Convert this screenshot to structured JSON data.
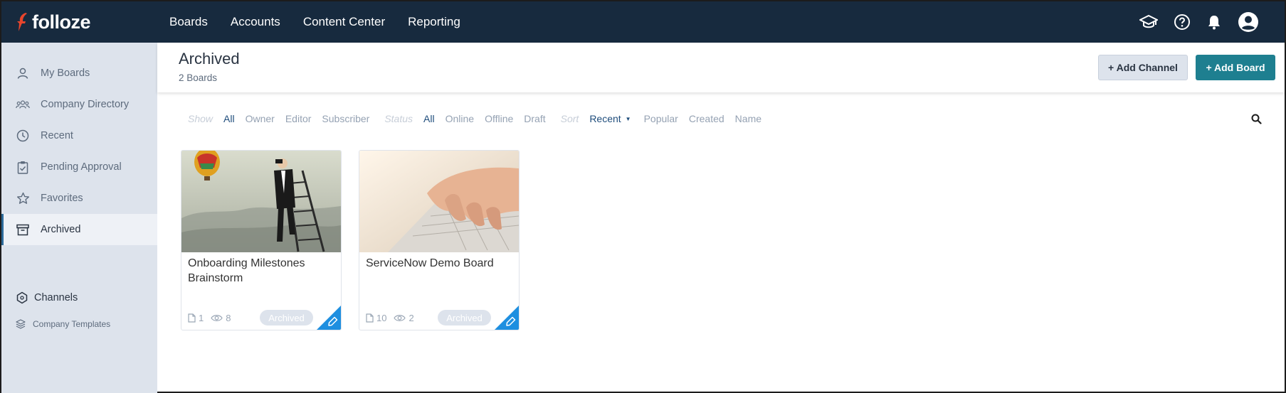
{
  "app": {
    "logo_text": "folloze"
  },
  "topnav": {
    "items": [
      "Boards",
      "Accounts",
      "Content Center",
      "Reporting"
    ]
  },
  "top_icons": [
    "graduation-cap-icon",
    "help-icon",
    "bell-icon",
    "user-account-icon"
  ],
  "sidebar": {
    "items": [
      {
        "label": "My Boards",
        "icon": "user-icon"
      },
      {
        "label": "Company Directory",
        "icon": "group-icon"
      },
      {
        "label": "Recent",
        "icon": "clock-icon"
      },
      {
        "label": "Pending Approval",
        "icon": "clipboard-check-icon"
      },
      {
        "label": "Favorites",
        "icon": "star-icon"
      },
      {
        "label": "Archived",
        "icon": "archive-icon",
        "active": true
      }
    ],
    "channels_label": "Channels",
    "templates_label": "Company Templates"
  },
  "header": {
    "title": "Archived",
    "subtitle": "2 Boards",
    "add_channel": "+ Add Channel",
    "add_board": "+ Add Board"
  },
  "filters": {
    "show_label": "Show",
    "show_options": [
      "All",
      "Owner",
      "Editor",
      "Subscriber"
    ],
    "status_label": "Status",
    "status_options": [
      "All",
      "Online",
      "Offline",
      "Draft"
    ],
    "sort_label": "Sort",
    "sort_options": [
      "Recent",
      "Popular",
      "Created",
      "Name"
    ],
    "show_selected": "All",
    "status_selected": "All",
    "sort_selected": "Recent"
  },
  "boards": [
    {
      "title": "Onboarding Milestones Brainstorm",
      "items": "1",
      "views": "8",
      "status": "Archived"
    },
    {
      "title": "ServiceNow Demo Board",
      "items": "10",
      "views": "2",
      "status": "Archived"
    }
  ],
  "colors": {
    "topbar": "#172a3e",
    "sidebar": "#dde3ec",
    "accent": "#1e7f90",
    "edit_corner": "#1e8fe0"
  }
}
